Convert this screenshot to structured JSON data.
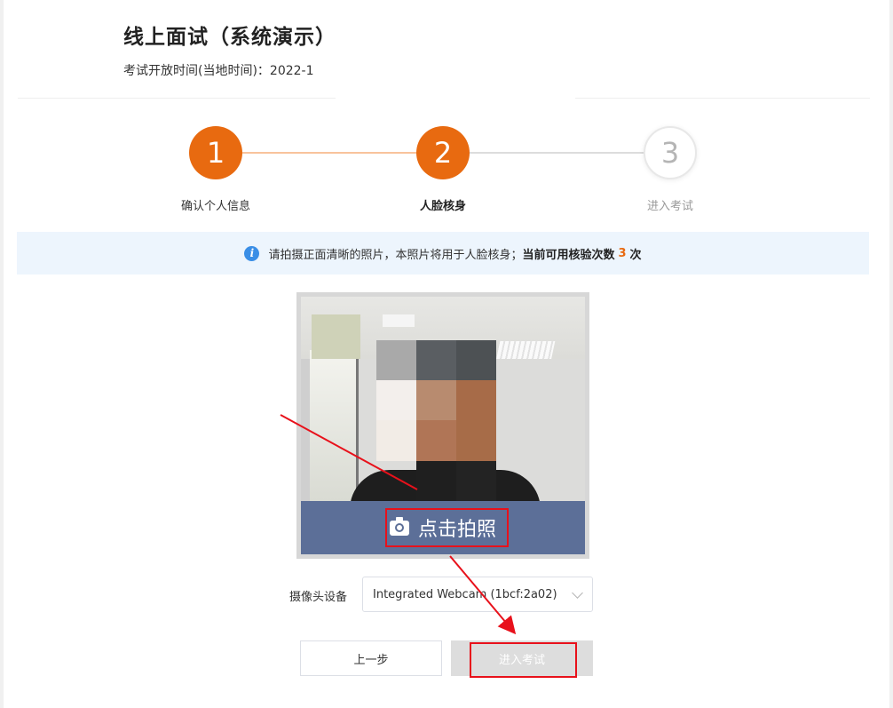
{
  "header": {
    "title": "线上面试（系统演示）",
    "subtitle": "考试开放时间(当地时间)：2022-1"
  },
  "steps": [
    {
      "number": "1",
      "label": "确认个人信息",
      "state": "done"
    },
    {
      "number": "2",
      "label": "人脸核身",
      "state": "active"
    },
    {
      "number": "3",
      "label": "进入考试",
      "state": "pending"
    }
  ],
  "notice": {
    "text": "请拍摄正面清晰的照片，本照片将用于人脸核身；",
    "bold_text": "当前可用核验次数",
    "count": "3",
    "unit": "次"
  },
  "camera": {
    "capture_label": "点击拍照"
  },
  "device": {
    "label": "摄像头设备",
    "selected": "Integrated Webcam (1bcf:2a02)"
  },
  "buttons": {
    "prev": "上一步",
    "enter": "进入考试"
  },
  "colors": {
    "accent": "#e86a10",
    "notice_bg": "#edf5fd",
    "annotation": "#e8111b",
    "capture_bar": "#5c6f98"
  }
}
